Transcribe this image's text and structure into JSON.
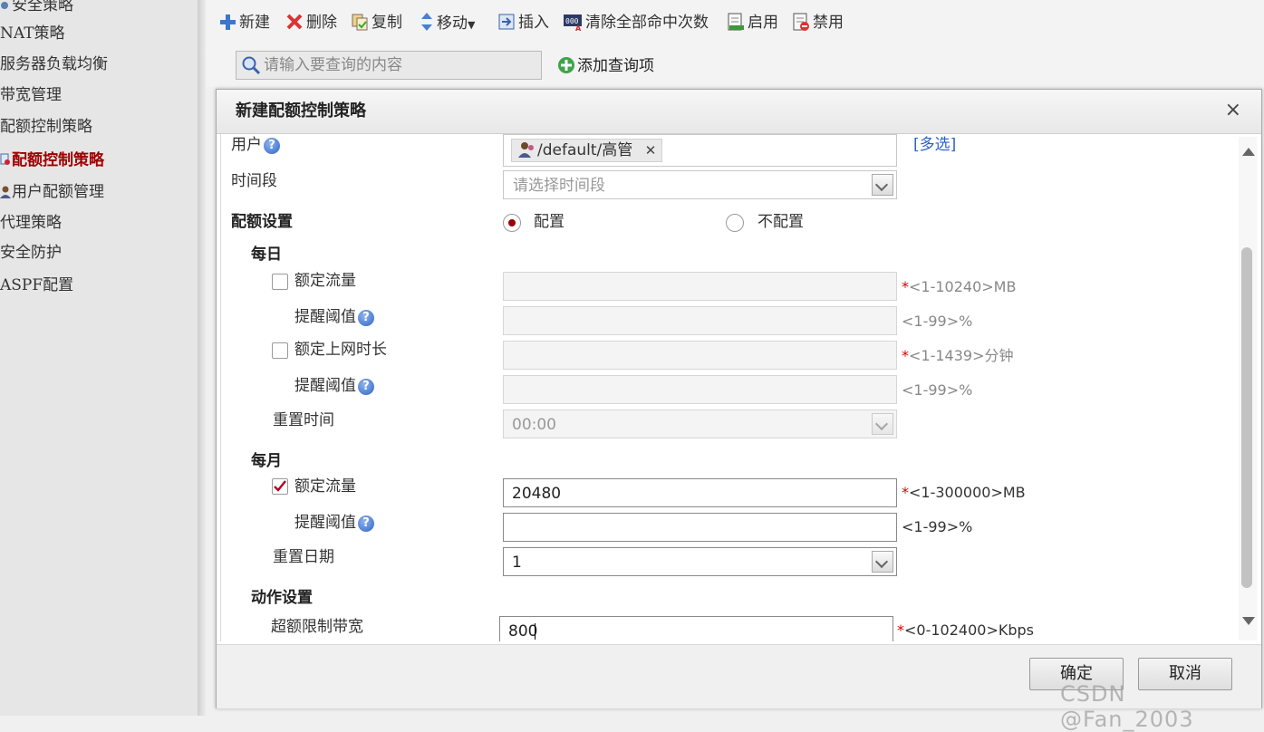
{
  "sidebar": {
    "items": [
      {
        "label": "安全策略",
        "icon": "",
        "active": false
      },
      {
        "label": "NAT策略",
        "icon": "",
        "active": false
      },
      {
        "label": "服务器负载均衡",
        "icon": "",
        "active": false
      },
      {
        "label": "带宽管理",
        "icon": "",
        "active": false
      },
      {
        "label": "配额控制策略",
        "icon": "",
        "active": false
      },
      {
        "label": "配额控制策略",
        "icon": "policy-icon",
        "active": true
      },
      {
        "label": "用户配额管理",
        "icon": "user-icon",
        "active": false
      },
      {
        "label": "代理策略",
        "icon": "",
        "active": false
      },
      {
        "label": "安全防护",
        "icon": "",
        "active": false
      },
      {
        "label": "ASPF配置",
        "icon": "",
        "active": false
      }
    ]
  },
  "toolbar": {
    "new": "新建",
    "delete": "删除",
    "copy": "复制",
    "move": "移动",
    "insert": "插入",
    "clear_hits": "清除全部命中次数",
    "enable": "启用",
    "disable": "禁用"
  },
  "search": {
    "placeholder": "请输入要查询的内容",
    "add_query": "添加查询项"
  },
  "dialog": {
    "title": "新建配额控制策略",
    "close": "×",
    "user_label": "用户",
    "user_tag": "/default/高管",
    "user_tag_remove": "✕",
    "multi_select": "[多选]",
    "time_label": "时间段",
    "time_placeholder": "请选择时间段",
    "quota_settings": "配额设置",
    "radio_config": "配置",
    "radio_no_config": "不配置",
    "quota_mode": "配置",
    "daily": {
      "title": "每日",
      "traffic_label": "额定流量",
      "traffic_checked": false,
      "traffic_value": "",
      "traffic_hint_req": "*",
      "traffic_hint": "<1-10240>MB",
      "alert1_label": "提醒阈值",
      "alert1_value": "",
      "alert1_hint": "<1-99>%",
      "online_label": "额定上网时长",
      "online_checked": false,
      "online_value": "",
      "online_hint_req": "*",
      "online_hint": "<1-1439>分钟",
      "alert2_label": "提醒阈值",
      "alert2_value": "",
      "alert2_hint": "<1-99>%",
      "reset_label": "重置时间",
      "reset_value": "00:00"
    },
    "monthly": {
      "title": "每月",
      "traffic_label": "额定流量",
      "traffic_checked": true,
      "traffic_value": "20480",
      "traffic_hint_req": "*",
      "traffic_hint": "<1-300000>MB",
      "alert_label": "提醒阈值",
      "alert_value": "",
      "alert_hint": "<1-99>%",
      "reset_label": "重置日期",
      "reset_value": "1"
    },
    "action": {
      "title": "动作设置",
      "limit_label": "超额限制带宽",
      "limit_value": "800",
      "limit_hint_req": "*",
      "limit_hint": "<0-102400>Kbps"
    },
    "ok": "确定",
    "cancel": "取消"
  },
  "watermark": "CSDN @Fan_2003",
  "colors": {
    "active_nav": "#a00000",
    "radio_dot": "#9c0000",
    "link": "#2a63c8",
    "required": "#dd0000"
  }
}
